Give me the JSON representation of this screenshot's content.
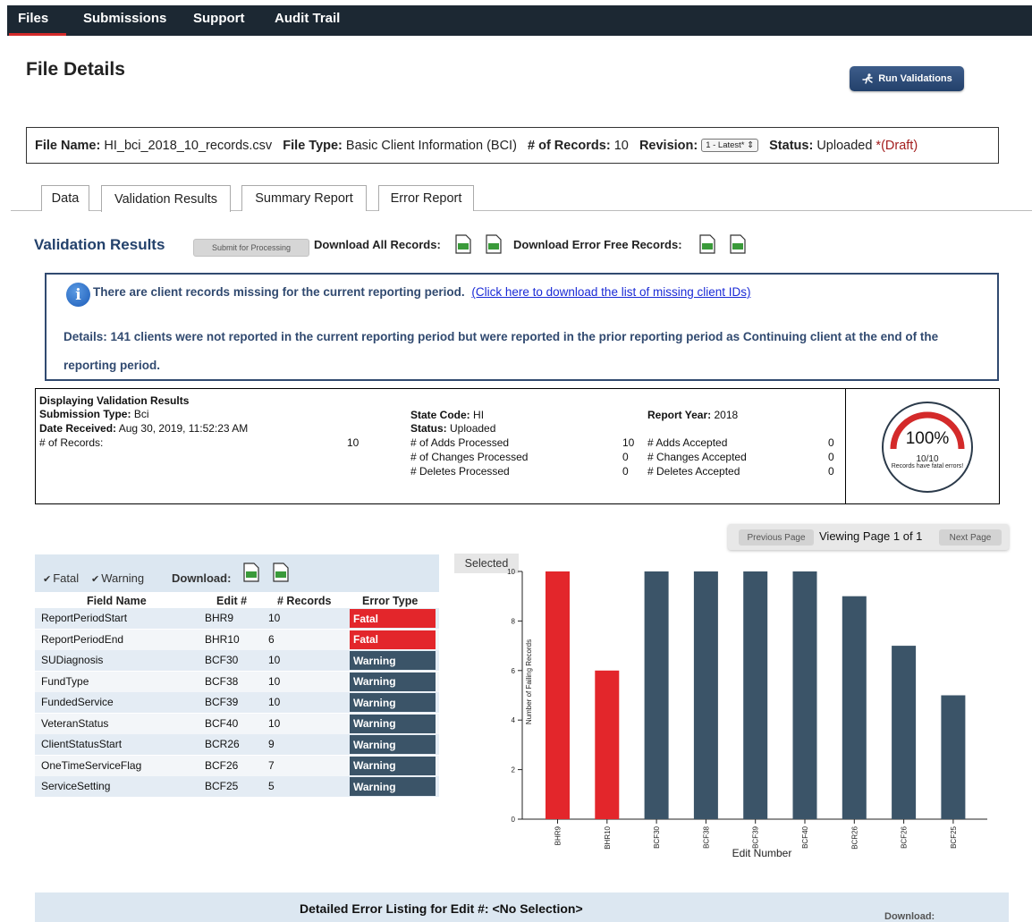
{
  "nav": {
    "items": [
      "Files",
      "Submissions",
      "Support",
      "Audit Trail"
    ],
    "active": "Files"
  },
  "page": {
    "title": "File Details",
    "run_validations_label": "Run Validations"
  },
  "file_bar": {
    "name_label": "File Name:",
    "name": "HI_bci_2018_10_records.csv",
    "type_label": "File Type:",
    "type": "Basic Client Information (BCI)",
    "records_label": "# of Records:",
    "records": "10",
    "revision_label": "Revision:",
    "revision_value": "1 - Latest*",
    "status_label": "Status:",
    "status": "Uploaded",
    "draft": "*(Draft)"
  },
  "tabs": [
    {
      "label": "Data",
      "active": false
    },
    {
      "label": "Validation Results",
      "active": true
    },
    {
      "label": "Summary Report",
      "active": false
    },
    {
      "label": "Error Report",
      "active": false
    }
  ],
  "validation": {
    "heading": "Validation Results",
    "submit_label": "Submit for Processing",
    "download_all_label": "Download All Records:",
    "download_error_free_label": "Download Error Free Records:",
    "file_icons": [
      "xls-file-icon",
      "csv-file-icon"
    ]
  },
  "info": {
    "message": "There are client records missing for the current reporting period.",
    "link_text": "(Click here to download the list of missing client IDs)",
    "details": "Details: 141 clients were not reported in the current reporting period but were reported in the prior reporting period as Continuing client at the end of the reporting period."
  },
  "summary": {
    "heading": "Displaying Validation Results",
    "submission_type_label": "Submission Type:",
    "submission_type": "Bci",
    "date_received_label": "Date Received:",
    "date_received": "Aug 30, 2019, 11:52:23 AM",
    "records_label": "# of Records:",
    "records": "10",
    "state_code_label": "State Code:",
    "state_code": "HI",
    "status_label": "Status:",
    "status": "Uploaded",
    "adds_processed_label": "# of Adds Processed",
    "adds_processed": "10",
    "changes_processed_label": "# of Changes Processed",
    "changes_processed": "0",
    "deletes_processed_label": "# Deletes Processed",
    "deletes_processed": "0",
    "report_year_label": "Report Year:",
    "report_year": "2018",
    "adds_accepted_label": "# Adds Accepted",
    "adds_accepted": "0",
    "changes_accepted_label": "# Changes Accepted",
    "changes_accepted": "0",
    "deletes_accepted_label": "# Deletes Accepted",
    "deletes_accepted": "0",
    "gauge": {
      "percent_text": "100%",
      "fraction": "10/10",
      "message": "Records have fatal errors!",
      "value": 1.0,
      "color": "#d42a2a"
    }
  },
  "pager": {
    "prev_label": "Previous Page",
    "text": "Viewing Page 1 of 1",
    "next_label": "Next Page"
  },
  "error_table": {
    "filter_fatal": "Fatal",
    "filter_warning": "Warning",
    "download_label": "Download:",
    "headers": [
      "Field Name",
      "Edit #",
      "# Records",
      "Error Type"
    ],
    "rows": [
      {
        "field": "ReportPeriodStart",
        "edit": "BHR9",
        "records": "10",
        "type": "Fatal"
      },
      {
        "field": "ReportPeriodEnd",
        "edit": "BHR10",
        "records": "6",
        "type": "Fatal"
      },
      {
        "field": "SUDiagnosis",
        "edit": "BCF30",
        "records": "10",
        "type": "Warning"
      },
      {
        "field": "FundType",
        "edit": "BCF38",
        "records": "10",
        "type": "Warning"
      },
      {
        "field": "FundedService",
        "edit": "BCF39",
        "records": "10",
        "type": "Warning"
      },
      {
        "field": "VeteranStatus",
        "edit": "BCF40",
        "records": "10",
        "type": "Warning"
      },
      {
        "field": "ClientStatusStart",
        "edit": "BCR26",
        "records": "9",
        "type": "Warning"
      },
      {
        "field": "OneTimeServiceFlag",
        "edit": "BCF26",
        "records": "7",
        "type": "Warning"
      },
      {
        "field": "ServiceSetting",
        "edit": "BCF25",
        "records": "5",
        "type": "Warning"
      }
    ],
    "colors": {
      "fatal": "#e3262b",
      "warning": "#3b5468"
    }
  },
  "chart_selected_label": "Selected",
  "chart_data": {
    "type": "bar",
    "categories": [
      "BHR9",
      "BHR10",
      "BCF30",
      "BCF38",
      "BCF39",
      "BCF40",
      "BCR26",
      "BCF26",
      "BCF25"
    ],
    "values": [
      10,
      6,
      10,
      10,
      10,
      10,
      9,
      7,
      5
    ],
    "bar_types": [
      "Fatal",
      "Fatal",
      "Warning",
      "Warning",
      "Warning",
      "Warning",
      "Warning",
      "Warning",
      "Warning"
    ],
    "colors": {
      "Fatal": "#e3262b",
      "Warning": "#3b5468"
    },
    "xlabel": "Edit Number",
    "ylabel": "Number of Failing Records",
    "ylim": [
      0,
      10
    ],
    "yticks": [
      "0",
      "2",
      "4",
      "6",
      "8",
      "10"
    ],
    "grid": false
  },
  "footer": {
    "title": "Detailed Error Listing for Edit #: <No Selection>",
    "download_label": "Download:"
  }
}
